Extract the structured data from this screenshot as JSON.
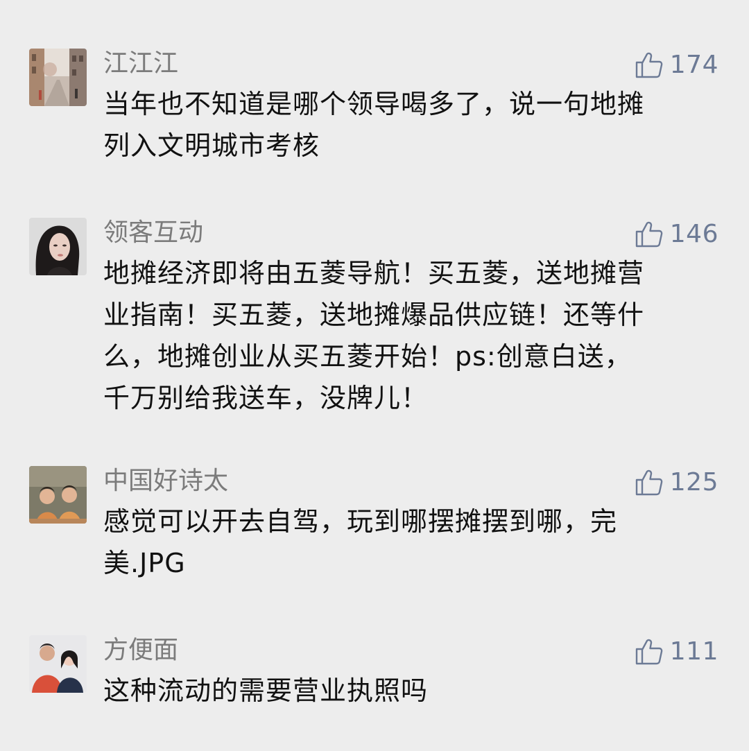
{
  "comments": [
    {
      "nickname": "江江江",
      "likes": "174",
      "avatar": "street-photo-avatar",
      "lines": [
        "当年也不知道是哪个领导喝多了，说一句地摊",
        "列入文明城市考核"
      ]
    },
    {
      "nickname": "领客互动",
      "likes": "146",
      "avatar": "woman-portrait-avatar",
      "lines": [
        "地摊经济即将由五菱导航！买五菱，送地摊营",
        "业指南！买五菱，送地摊爆品供应链！还等什",
        "么，地摊创业从买五菱开始！ps:创意白送，",
        "千万别给我送车，没牌儿！"
      ]
    },
    {
      "nickname": "中国好诗太",
      "likes": "125",
      "avatar": "two-children-photo-avatar",
      "lines": [
        "感觉可以开去自驾，玩到哪摆摊摆到哪，完",
        "美.JPG"
      ]
    },
    {
      "nickname": "方便面",
      "likes": "111",
      "avatar": "couple-photo-avatar",
      "lines": [
        "这种流动的需要营业执照吗"
      ]
    }
  ],
  "colors": {
    "background": "#ededed",
    "nickname": "#7b7b7b",
    "like": "#6c7a95",
    "text": "#111111"
  }
}
